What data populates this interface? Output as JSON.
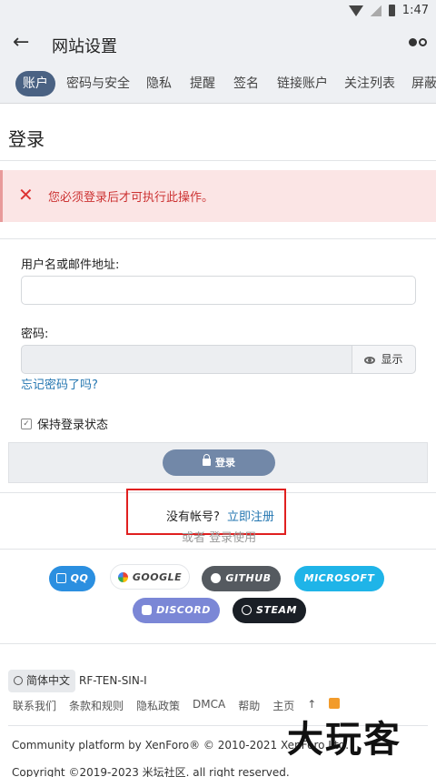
{
  "status": {
    "time": "1:47"
  },
  "appbar": {
    "title": "网站设置"
  },
  "tabs": [
    "账户",
    "密码与安全",
    "隐私",
    "提醒",
    "签名",
    "链接账户",
    "关注列表",
    "屏蔽"
  ],
  "page": {
    "title": "登录"
  },
  "error": {
    "message": "您必须登录后才可执行此操作。"
  },
  "form": {
    "username_label": "用户名或邮件地址:",
    "username_value": "",
    "password_label": "密码:",
    "show_label": "显示",
    "forgot": "忘记密码了吗?",
    "remember": "保持登录状态",
    "submit": "登录"
  },
  "register": {
    "question": "没有帐号?",
    "link": "立即注册"
  },
  "or_text": "或者 登录使用",
  "social": {
    "qq": "QQ",
    "google": "GOOGLE",
    "github": "GITHUB",
    "microsoft": "MICROSOFT",
    "discord": "DISCORD",
    "steam": "STEAM"
  },
  "footer": {
    "language": "简体中文",
    "style": "RF-TEN-SIN-I",
    "links": [
      "联系我们",
      "条款和规则",
      "隐私政策",
      "DMCA",
      "帮助",
      "主页",
      "↑"
    ],
    "platform": "Community platform by XenForo® © 2010-2021 XenForo Ltd.",
    "copyright": "Copyright ©2019-2023 米坛社区. all right reserved."
  },
  "watermark": "大玩客",
  "colors": {
    "accent": "#4a6283",
    "link": "#2577b1",
    "error": "#d33333",
    "highlight": "#e02020"
  }
}
